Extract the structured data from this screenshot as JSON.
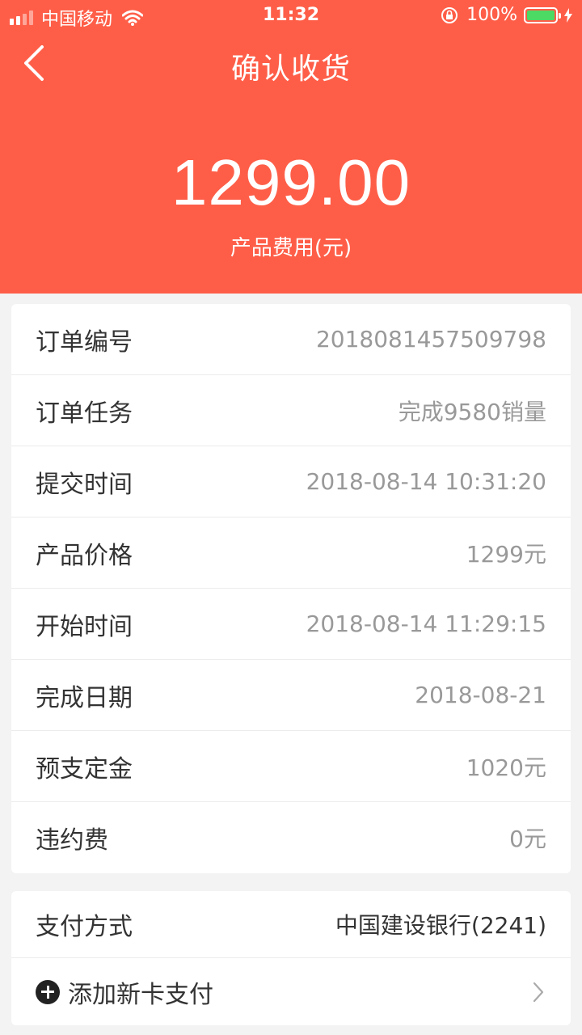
{
  "status_bar": {
    "carrier": "中国移动",
    "time": "11:32",
    "battery": "100%",
    "battery_color": "#4cd964"
  },
  "header": {
    "title": "确认收货",
    "amount": "1299.00",
    "amount_label": "产品费用(元)",
    "background": "#fe5e48"
  },
  "details": [
    {
      "label": "订单编号",
      "value": "2018081457509798"
    },
    {
      "label": "订单任务",
      "value": "完成9580销量"
    },
    {
      "label": "提交时间",
      "value": "2018-08-14 10:31:20"
    },
    {
      "label": "产品价格",
      "value": "1299元"
    },
    {
      "label": "开始时间",
      "value": "2018-08-14 11:29:15"
    },
    {
      "label": "完成日期",
      "value": "2018-08-21"
    },
    {
      "label": "预支定金",
      "value": "1020元"
    },
    {
      "label": "违约费",
      "value": "0元"
    }
  ],
  "payment": {
    "label": "支付方式",
    "value": "中国建设银行(2241)",
    "add_card": "添加新卡支付"
  },
  "icons": [
    "signal-icon",
    "wifi-icon",
    "rotation-lock-icon",
    "battery-icon",
    "charging-icon",
    "back-arrow-icon",
    "add-circle-icon",
    "chevron-right-icon"
  ]
}
